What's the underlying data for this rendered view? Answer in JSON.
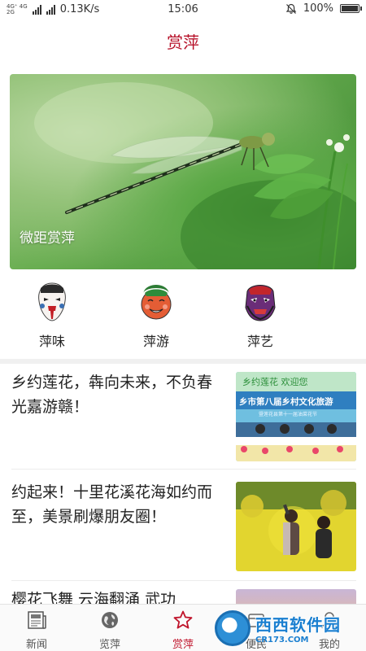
{
  "status_bar": {
    "network_top": "4G⁺ 4G",
    "network_bottom": "2G",
    "speed": "0.13K/s",
    "time": "15:06",
    "battery": "100%"
  },
  "header": {
    "title": "赏萍"
  },
  "banner": {
    "caption": "微距赏萍"
  },
  "categories": [
    {
      "label": "萍味",
      "icon": "opera-mask-white-icon"
    },
    {
      "label": "萍游",
      "icon": "smiling-mask-icon"
    },
    {
      "label": "萍艺",
      "icon": "fierce-mask-icon"
    }
  ],
  "news": [
    {
      "title": "乡约莲花，犇向未来，不负春光嘉游赣！",
      "thumb_banner_text": "乡约莲花 欢迎您",
      "thumb_heading": "乡市第八届乡村文化旅游",
      "thumb_subheading": "暨莲花县第十一届油菜花节"
    },
    {
      "title": "约起来！十里花溪花海如约而至，美景刷爆朋友圈！"
    },
    {
      "title": "樱花飞舞 云海翻涌 武功"
    }
  ],
  "tabs": [
    {
      "label": "新闻",
      "icon": "newspaper-icon",
      "active": false
    },
    {
      "label": "览萍",
      "icon": "globe-icon",
      "active": false
    },
    {
      "label": "赏萍",
      "icon": "star-icon",
      "active": true
    },
    {
      "label": "便民",
      "icon": "service-icon",
      "active": false
    },
    {
      "label": "我的",
      "icon": "profile-icon",
      "active": false
    }
  ],
  "watermark": {
    "main": "西西软件园",
    "sub": "CR173.COM"
  },
  "colors": {
    "accent": "#b7122a",
    "active_tab": "#c0152c"
  }
}
